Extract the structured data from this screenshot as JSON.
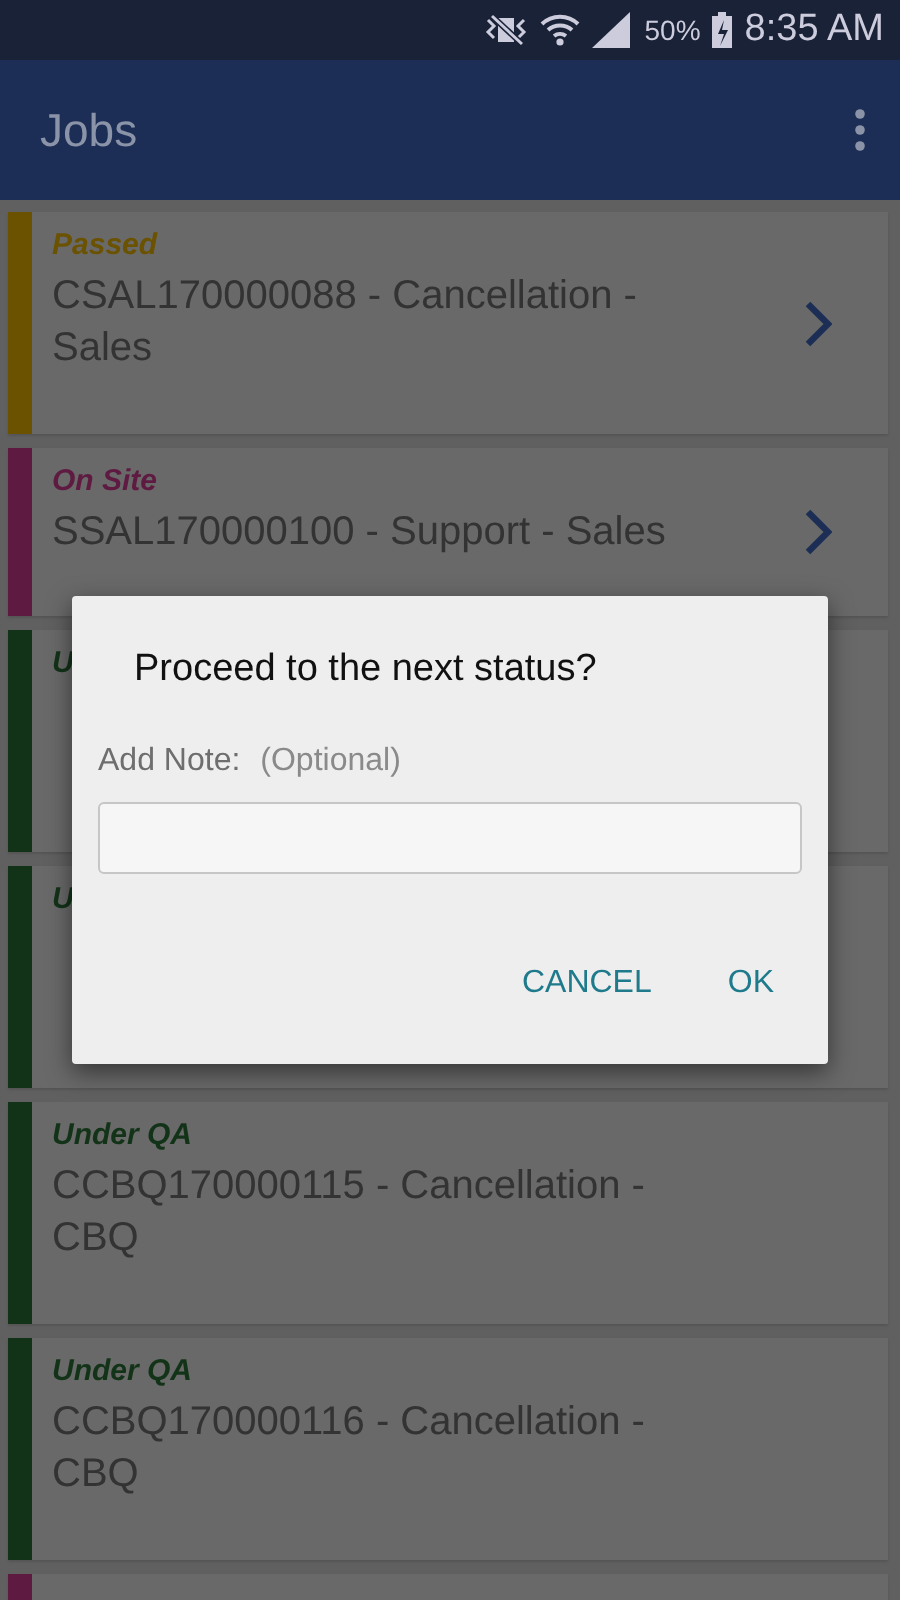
{
  "status_bar": {
    "battery": "50%",
    "time": "8:35 AM"
  },
  "app_bar": {
    "title": "Jobs"
  },
  "jobs": [
    {
      "status": "Passed",
      "color": "#6b5200",
      "title": [
        "CSAL170000088 - Cancellation -",
        "Sales"
      ],
      "chevron": true
    },
    {
      "status": "On Site",
      "color": "#5e1a40",
      "title": [
        "SSAL170000100 - Support - Sales"
      ],
      "chevron": true
    },
    {
      "status": "U",
      "color": "#123318",
      "chevron": false
    },
    {
      "status": "U",
      "color": "#123318",
      "chevron": false
    },
    {
      "status": "Under QA",
      "color": "#123318",
      "title": [
        "CCBQ170000115 - Cancellation -",
        "CBQ"
      ],
      "chevron": false
    },
    {
      "status": "Under QA",
      "color": "#123318",
      "title": [
        "CCBQ170000116 - Cancellation -",
        "CBQ"
      ],
      "chevron": false
    },
    {
      "color": "#5e1a40",
      "chevron": false
    }
  ],
  "dialog": {
    "title": "Proceed to the next status?",
    "note_label": "Add Note:",
    "note_hint": "(Optional)",
    "buttons": [
      "CANCEL",
      "OK"
    ]
  }
}
